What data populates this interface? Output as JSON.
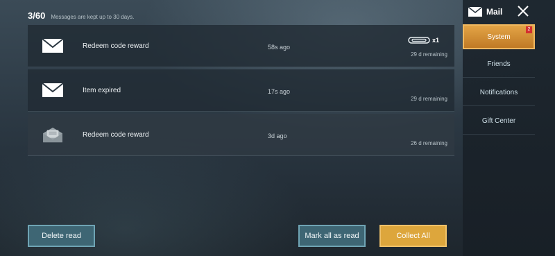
{
  "header": {
    "count": "3/60",
    "note": "Messages are kept up to 30 days."
  },
  "mails": [
    {
      "title": "Redeem code reward",
      "time": "58s ago",
      "remaining": "29 d remaining",
      "read": false,
      "icon": "envelope-closed-icon",
      "attachment": {
        "icon": "paperclip-icon",
        "qty": "x1"
      }
    },
    {
      "title": "Item expired",
      "time": "17s ago",
      "remaining": "29 d remaining",
      "read": false,
      "icon": "envelope-closed-icon"
    },
    {
      "title": "Redeem code reward",
      "time": "3d ago",
      "remaining": "26 d remaining",
      "read": true,
      "icon": "envelope-open-icon"
    }
  ],
  "sidebar": {
    "title": "Mail",
    "items": [
      {
        "label": "System",
        "badge": "2",
        "active": true
      },
      {
        "label": "Friends"
      },
      {
        "label": "Notifications"
      },
      {
        "label": "Gift Center"
      }
    ]
  },
  "buttons": {
    "delete_read": "Delete read",
    "mark_all_read": "Mark all as read",
    "collect_all": "Collect All"
  },
  "colors": {
    "accent_gold": "#dda63c",
    "button_teal": "#3e6674",
    "badge_red": "#d32f2f"
  }
}
